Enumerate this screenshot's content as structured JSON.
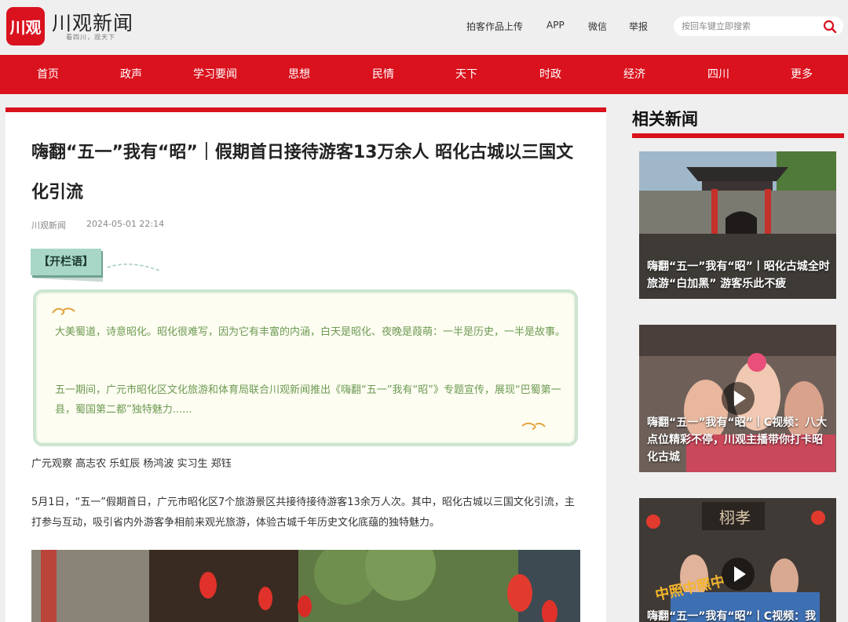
{
  "header": {
    "logo_mark": "川观",
    "logo_name": "川观新闻",
    "logo_slogan": "看四川，观天下",
    "links": [
      "拍客作品上传",
      "APP",
      "微信",
      "举报"
    ],
    "search_placeholder": "按回车键立即搜索"
  },
  "nav": {
    "items": [
      "首页",
      "政声",
      "学习要闻",
      "思想",
      "民情",
      "天下",
      "时政",
      "经济",
      "四川",
      "更多"
    ]
  },
  "article": {
    "title": "嗨翻“五一”我有“昭”｜假期首日接待游客13万余人 昭化古城以三国文化引流",
    "source": "川观新闻",
    "time": "2024-05-01 22:14",
    "column_tag": "【开栏语】",
    "intro": [
      "大美蜀道，诗意昭化。昭化很难写，因为它有丰富的内涵，白天是昭化、夜晚是葭萌：一半是历史，一半是故事。",
      "五一期间，广元市昭化区文化旅游和体育局联合川观新闻推出《嗨翻“五一”我有“昭”》专题宣传，展现“巴蜀第一县，蜀国第二都”独特魅力......"
    ],
    "authors": "广元观察 高志农 乐虹辰 杨鸿波 实习生 郑钰",
    "paragraph": "5月1日，“五一”假期首日，广元市昭化区7个旅游景区共接待接待游客13余万人次。其中，昭化古城以三国文化引流，主打参与互动，吸引省内外游客争相前来观光旅游，体验古城千年历史文化底蕴的独特魅力。"
  },
  "sidebar": {
    "title": "相关新闻",
    "cards": [
      {
        "caption": "嗨翻“五一”我有“昭”丨昭化古城全时旅游“白加黑” 游客乐此不疲"
      },
      {
        "caption": "嗨翻“五一”我有“昭”丨C视频：八大点位精彩不停，川观主播带你打卡昭化古城"
      },
      {
        "caption": "嗨翻“五一”我有“昭”丨C视频：我",
        "overlay_text": "中照中照中",
        "sign_text": "栩孝"
      }
    ]
  },
  "colors": {
    "brand_red": "#d9121e",
    "intro_text": "#6c9a52",
    "intro_border": "#cde5cf"
  }
}
